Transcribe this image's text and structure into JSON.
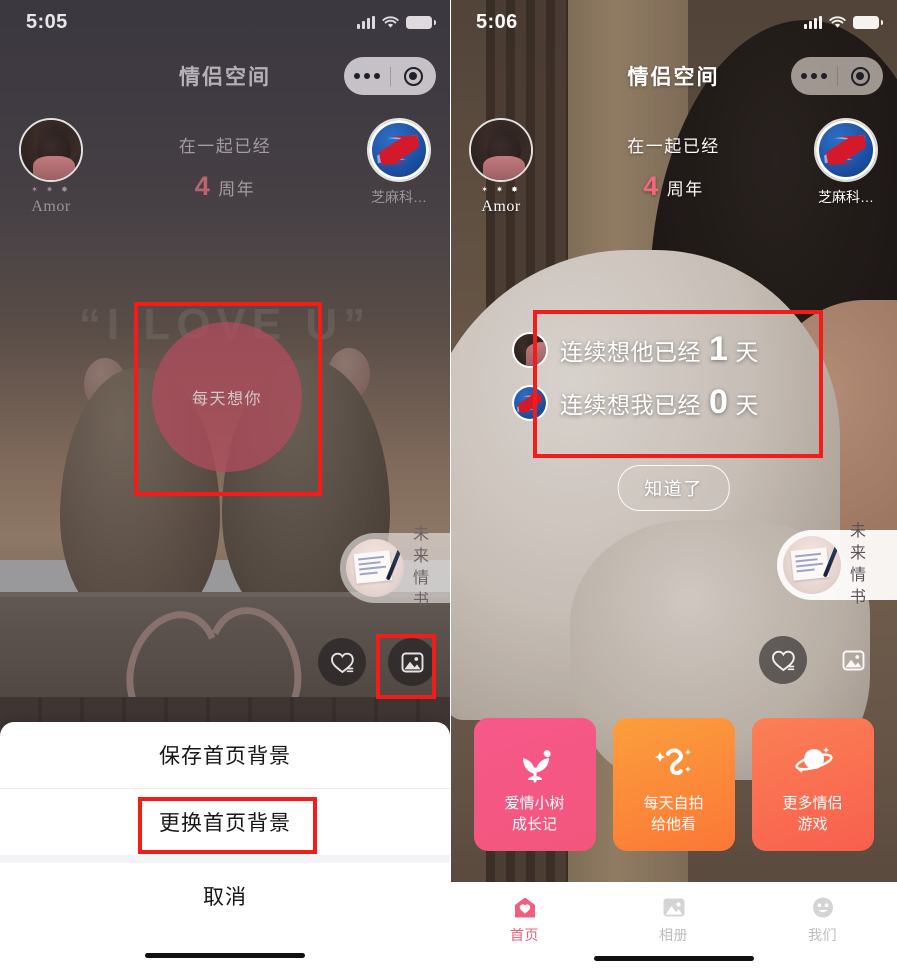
{
  "meta": {
    "app_name": "情侣空间",
    "screens": 2
  },
  "left": {
    "status": {
      "time": "5:05",
      "icons": [
        "cellular-signal-icon",
        "wifi-icon",
        "battery-icon"
      ]
    },
    "header": {
      "title": "情侣空间",
      "capsule": {
        "menu_icon": "more-dots-icon",
        "target_icon": "target-circle-icon"
      }
    },
    "couple": {
      "left_avatar": {
        "name": "Amor",
        "stars": "✶ ✷ ✸",
        "icon": "user-avatar-photo"
      },
      "right_avatar": {
        "name": "芝麻科…",
        "icon": "zhima-logo"
      },
      "anniversary_line1": "在一起已经",
      "anniversary_number": "4",
      "anniversary_unit": "周年"
    },
    "bubble": {
      "label": "每天想你",
      "color": "#b04c5c"
    },
    "background_text": "“I LOVE U”",
    "letter_pill": {
      "line1": "未来",
      "line2": "情书",
      "thumb_icon": "love-letter-thumb"
    },
    "actions": [
      {
        "name": "like-heart-button",
        "icon": "heart-icon"
      },
      {
        "name": "change-background-button",
        "icon": "image-picture-icon"
      }
    ],
    "sheet": {
      "items": [
        {
          "label": "保存首页背景",
          "highlighted": false
        },
        {
          "label": "更换首页背景",
          "highlighted": true
        }
      ],
      "cancel_label": "取消"
    },
    "annotations": [
      {
        "name": "bubble-highlight-box",
        "color": "#f41c18"
      },
      {
        "name": "image-icon-highlight-box",
        "color": "#f41c18"
      },
      {
        "name": "change-background-highlight-box",
        "color": "#f41c18"
      }
    ]
  },
  "right": {
    "status": {
      "time": "5:06",
      "icons": [
        "cellular-signal-icon",
        "wifi-icon",
        "battery-icon"
      ]
    },
    "header": {
      "title": "情侣空间",
      "capsule": {
        "menu_icon": "more-dots-icon",
        "target_icon": "target-circle-icon"
      }
    },
    "couple": {
      "left_avatar": {
        "name": "Amor",
        "stars": "✶ ✷ ✸",
        "icon": "user-avatar-photo"
      },
      "right_avatar": {
        "name": "芝麻科…",
        "icon": "zhima-logo"
      },
      "anniversary_line1": "在一起已经",
      "anniversary_number": "4",
      "anniversary_unit": "周年"
    },
    "streak": {
      "rows": [
        {
          "avatar": "user-avatar-photo",
          "text": "连续想他已经",
          "count": "1",
          "unit": "天"
        },
        {
          "avatar": "zhima-logo",
          "text": "连续想我已经",
          "count": "0",
          "unit": "天"
        }
      ],
      "confirm_label": "知道了"
    },
    "letter_pill": {
      "line1": "未来",
      "line2": "情书",
      "thumb_icon": "love-letter-thumb"
    },
    "actions": [
      {
        "name": "like-heart-button",
        "icon": "heart-icon"
      },
      {
        "name": "change-background-button",
        "icon": "image-picture-icon"
      }
    ],
    "cards": [
      {
        "label_line1": "爱情小树",
        "label_line2": "成长记",
        "icon": "sprout-plant-icon",
        "color_from": "#f7587f",
        "color_to": "#f0557c"
      },
      {
        "label_line1": "每天自拍",
        "label_line2": "给他看",
        "icon": "sparkle-swirl-icon",
        "color_from": "#fb9a3c",
        "color_to": "#fb7a38"
      },
      {
        "label_line1": "更多情侣",
        "label_line2": "游戏",
        "icon": "planet-saturn-icon",
        "color_from": "#fb7b54",
        "color_to": "#f8614f"
      }
    ],
    "tabs": [
      {
        "label": "首页",
        "icon": "home-heart-icon",
        "active": true,
        "color": "#f0607c"
      },
      {
        "label": "相册",
        "icon": "photo-album-icon",
        "active": false,
        "color": "#bdbdbd"
      },
      {
        "label": "我们",
        "icon": "us-smiley-icon",
        "active": false,
        "color": "#bdbdbd"
      }
    ],
    "annotations": [
      {
        "name": "streak-highlight-box",
        "color": "#f41c18"
      }
    ]
  }
}
